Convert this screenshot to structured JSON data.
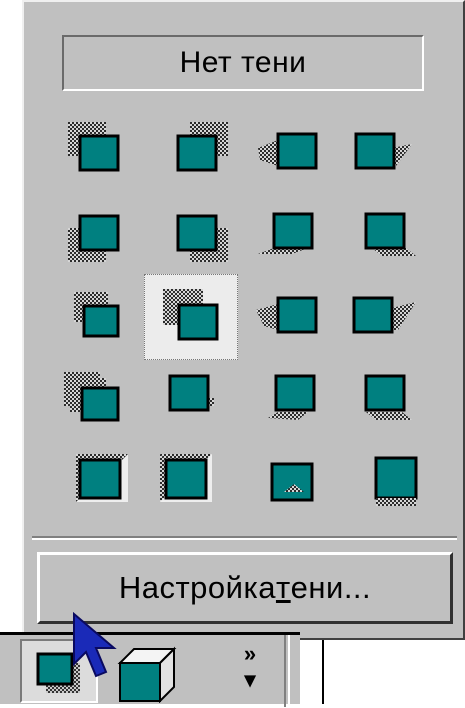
{
  "shadow_menu": {
    "no_shadow_label": "Нет тени",
    "settings_label_prefix": "Настройка ",
    "settings_label_underlined": "т",
    "settings_label_suffix": "ени..."
  },
  "shadow_styles": [
    {
      "row": 1,
      "col": 1,
      "selected": false,
      "icon": "shadow-style-icon"
    },
    {
      "row": 1,
      "col": 2,
      "selected": false,
      "icon": "shadow-style-icon"
    },
    {
      "row": 1,
      "col": 3,
      "selected": false,
      "icon": "shadow-style-icon"
    },
    {
      "row": 1,
      "col": 4,
      "selected": false,
      "icon": "shadow-style-icon"
    },
    {
      "row": 2,
      "col": 1,
      "selected": false,
      "icon": "shadow-style-icon"
    },
    {
      "row": 2,
      "col": 2,
      "selected": false,
      "icon": "shadow-style-icon"
    },
    {
      "row": 2,
      "col": 3,
      "selected": false,
      "icon": "shadow-style-icon"
    },
    {
      "row": 2,
      "col": 4,
      "selected": false,
      "icon": "shadow-style-icon"
    },
    {
      "row": 3,
      "col": 1,
      "selected": false,
      "icon": "shadow-style-icon"
    },
    {
      "row": 3,
      "col": 2,
      "selected": true,
      "icon": "shadow-style-icon"
    },
    {
      "row": 3,
      "col": 3,
      "selected": false,
      "icon": "shadow-style-icon"
    },
    {
      "row": 3,
      "col": 4,
      "selected": false,
      "icon": "shadow-style-icon"
    },
    {
      "row": 4,
      "col": 1,
      "selected": false,
      "icon": "shadow-style-icon"
    },
    {
      "row": 4,
      "col": 2,
      "selected": false,
      "icon": "shadow-style-icon"
    },
    {
      "row": 4,
      "col": 3,
      "selected": false,
      "icon": "shadow-style-icon"
    },
    {
      "row": 4,
      "col": 4,
      "selected": false,
      "icon": "shadow-style-icon"
    },
    {
      "row": 5,
      "col": 1,
      "selected": false,
      "icon": "shadow-style-icon"
    },
    {
      "row": 5,
      "col": 2,
      "selected": false,
      "icon": "shadow-style-icon"
    },
    {
      "row": 5,
      "col": 3,
      "selected": false,
      "icon": "shadow-style-icon"
    },
    {
      "row": 5,
      "col": 4,
      "selected": false,
      "icon": "shadow-style-icon"
    }
  ],
  "toolbar": {
    "chevron_label": "»",
    "dropdown_label": "▾",
    "shadow_button_icon": "shadow-icon",
    "threed_button_icon": "3d-style-icon"
  },
  "colors": {
    "face": "#c0c0c0",
    "teal": "#008080",
    "cursor": "#1a2ab8"
  }
}
